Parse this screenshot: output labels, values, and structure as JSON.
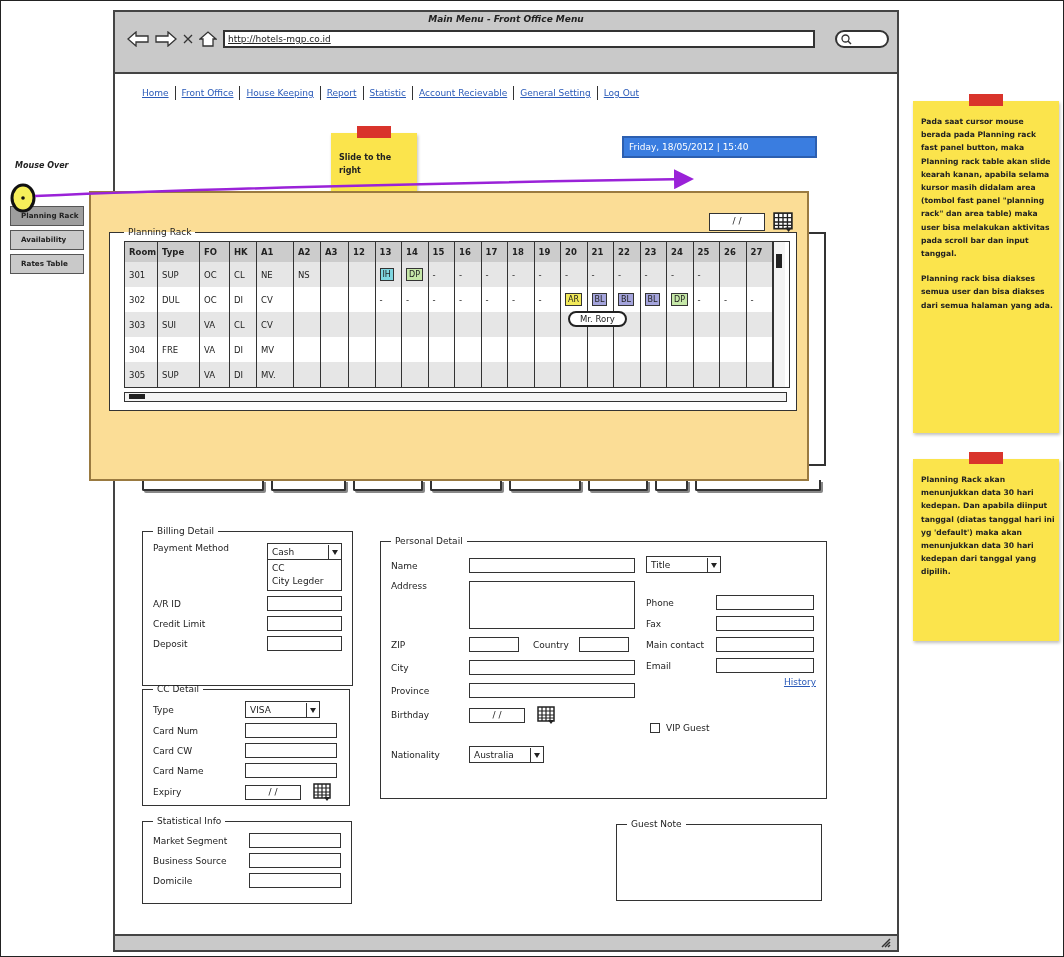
{
  "browser": {
    "title": "Main Menu - Front Office Menu",
    "url": "http://hotels-mgp.co.id"
  },
  "menu": [
    "Home",
    "Front Office",
    "House Keeping",
    "Report",
    "Statistic",
    "Account Recievable",
    "General Setting",
    "Log Out"
  ],
  "datetime": "Friday, 18/05/2012  |  15:40",
  "mouse_over": "Mouse Over",
  "slide_note": "Slide to the right",
  "fast_panel": [
    {
      "label": "Planning Rack",
      "selected": true
    },
    {
      "label": "Availability",
      "selected": false
    },
    {
      "label": "Rates Table",
      "selected": false
    }
  ],
  "planning_rack": {
    "title": "Planning Rack",
    "date": "/ /",
    "columns": [
      "Room",
      "Type",
      "FO",
      "HK",
      "A1",
      "A2",
      "A3",
      "12",
      "13",
      "14",
      "15",
      "16",
      "17",
      "18",
      "19",
      "20",
      "21",
      "22",
      "23",
      "24",
      "25",
      "26",
      "27"
    ],
    "rows": [
      {
        "cells": [
          "301",
          "SUP",
          "OC",
          "CL",
          "NE",
          "NS",
          null,
          null,
          {
            "text": "IH",
            "color": "#7fd6e0"
          },
          {
            "text": "DP",
            "color": "#c6e8a8"
          },
          "-",
          "-",
          "-",
          "-",
          "-",
          "-",
          "-",
          "-",
          "-",
          "-",
          "-",
          null,
          null
        ]
      },
      {
        "cells": [
          "302",
          "DUL",
          "OC",
          "DI",
          "CV",
          null,
          null,
          null,
          "-",
          "-",
          "-",
          "-",
          "-",
          "-",
          "-",
          {
            "text": "AR",
            "color": "#f2ea5a"
          },
          {
            "text": "BL",
            "color": "#a4a4dc"
          },
          {
            "text": "BL",
            "color": "#a4a4dc"
          },
          {
            "text": "BL",
            "color": "#a4a4dc"
          },
          {
            "text": "DP",
            "color": "#c6e8a8"
          },
          "-",
          "-",
          "-"
        ]
      },
      {
        "cells": [
          "303",
          "SUI",
          "VA",
          "CL",
          "CV",
          null,
          null,
          null,
          null,
          null,
          null,
          null,
          null,
          null,
          null,
          null,
          null,
          null,
          null,
          null,
          null,
          null,
          null
        ]
      },
      {
        "cells": [
          "304",
          "FRE",
          "VA",
          "DI",
          "MV",
          null,
          null,
          null,
          null,
          null,
          null,
          null,
          null,
          null,
          null,
          null,
          null,
          null,
          null,
          null,
          null,
          null,
          null
        ]
      },
      {
        "cells": [
          "305",
          "SUP",
          "VA",
          "DI",
          "MV.",
          null,
          null,
          null,
          null,
          null,
          null,
          null,
          null,
          null,
          null,
          null,
          null,
          null,
          null,
          null,
          null,
          null,
          null
        ]
      }
    ],
    "tooltip": "Mr. Rory"
  },
  "billing": {
    "title": "Billing Detail",
    "payment_label": "Payment Method",
    "payment_value": "Cash",
    "payment_options": [
      "CC",
      "City Legder"
    ],
    "fields": [
      "A/R ID",
      "Credit Limit",
      "Deposit"
    ]
  },
  "cc_detail": {
    "title": "CC Detail",
    "type_label": "Type",
    "type_value": "VISA",
    "fields": [
      "Card Num",
      "Card CW",
      "Card Name"
    ],
    "expiry_label": "Expiry",
    "expiry_value": "/ /"
  },
  "statistical": {
    "title": "Statistical Info",
    "fields": [
      "Market Segment",
      "Business Source",
      "Domicile"
    ]
  },
  "personal": {
    "title": "Personal Detail",
    "name_label": "Name",
    "title_select": "Title",
    "address_label": "Address",
    "zip_label": "ZIP",
    "country_label": "Country",
    "city_label": "City",
    "province_label": "Province",
    "birthday_label": "Birthday",
    "birthday_value": "/ /",
    "nationality_label": "Nationality",
    "nationality_value": "Australia",
    "contact_fields": [
      "Phone",
      "Fax",
      "Main contact",
      "Email"
    ],
    "history_link": "History",
    "vip": {
      "label": "VIP Guest",
      "checked": false
    }
  },
  "guest_note": {
    "title": "Guest Note"
  },
  "notes": [
    {
      "paragraphs": [
        "Pada saat cursor mouse berada pada Planning rack fast panel button, maka Planning rack table akan slide kearah kanan, apabila selama kursor masih didalam area (tombol fast panel \"planning rack\" dan area table) maka user bisa melakukan aktivitas pada scroll bar dan input tanggal.",
        "Planning rack bisa diakses semua user dan bisa diakses dari semua halaman yang ada."
      ]
    },
    {
      "paragraphs": [
        "Planning Rack akan menunjukkan data 30 hari kedepan. Dan apabila diinput tanggal (diatas tanggal hari ini yg 'default') maka akan menunjukkan data 30 hari kedepan dari tanggal yang dipilih."
      ]
    }
  ]
}
